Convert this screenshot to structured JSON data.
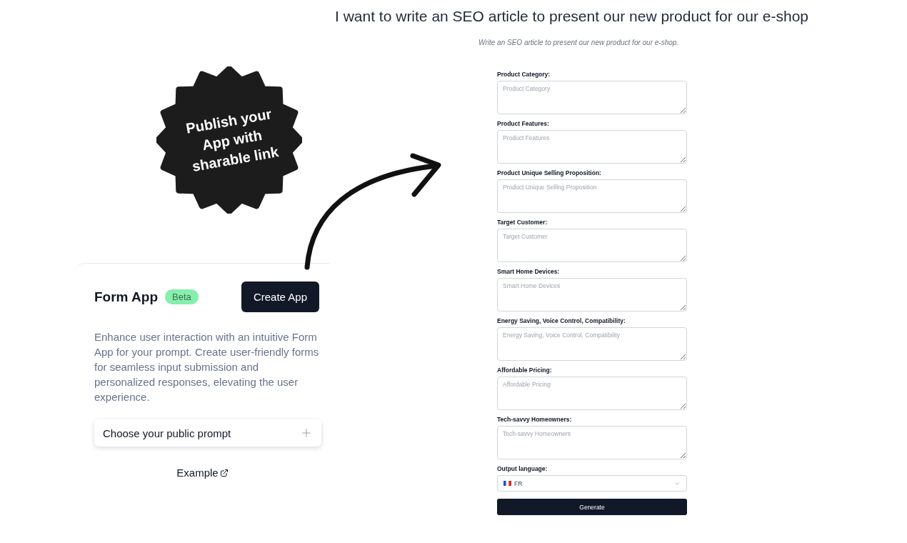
{
  "headline": "I want to write an SEO article to present our new product for our e-shop",
  "subtitle": "Write an SEO article to present our new product for our e-shop.",
  "badge": {
    "text": "Publish your App with sharable link"
  },
  "card": {
    "title": "Form App",
    "tag": "Beta",
    "create_button": "Create App",
    "description": "Enhance user interaction with an intuitive Form App for your prompt. Create user-friendly forms for seamless input submission and personalized responses, elevating the user experience.",
    "prompt_picker": {
      "label": "Choose your public prompt"
    },
    "example_link": "Example"
  },
  "form": {
    "fields": [
      {
        "label": "Product Category:",
        "placeholder": "Product Category"
      },
      {
        "label": "Product Features:",
        "placeholder": "Product Features"
      },
      {
        "label": "Product Unique Selling Proposition:",
        "placeholder": "Product Unique Selling Proposition"
      },
      {
        "label": "Target Customer:",
        "placeholder": "Target Customer"
      },
      {
        "label": "Smart Home Devices:",
        "placeholder": "Smart Home Devices"
      },
      {
        "label": "Energy Saving, Voice Control, Compatibility:",
        "placeholder": "Energy Saving, Voice Control, Compatibility"
      },
      {
        "label": "Affordable Pricing:",
        "placeholder": "Affordable Pricing"
      },
      {
        "label": "Tech-savvy Homeowners:",
        "placeholder": "Tech-savvy Homeowners"
      }
    ],
    "language": {
      "label": "Output language:",
      "value": "FR"
    },
    "submit": "Generate"
  }
}
